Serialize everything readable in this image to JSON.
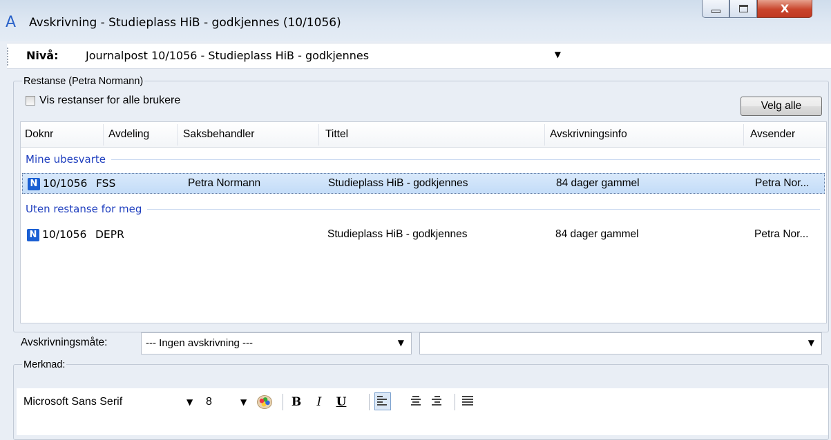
{
  "window": {
    "title": "Avskrivning - Studieplass HiB - godkjennes (10/1056)",
    "app_icon": "A",
    "close_glyph": "X"
  },
  "level": {
    "label": "Nivå:",
    "value": "Journalpost 10/1056 - Studieplass HiB - godkjennes"
  },
  "restanse": {
    "legend": "Restanse (Petra Normann)",
    "show_all_label": "Vis restanser for alle brukere",
    "select_all_label": "Velg alle",
    "columns": [
      "Doknr",
      "Avdeling",
      "Saksbehandler",
      "Tittel",
      "Avskrivningsinfo",
      "Avsender"
    ],
    "groups": [
      {
        "title": "Mine ubesvarte",
        "rows": [
          {
            "badge": "N",
            "doknr": "10/1056",
            "avdeling": "FSS",
            "saksbehandler": "Petra Normann",
            "tittel": "Studieplass HiB - godkjennes",
            "info": "84 dager gammel",
            "avsender": "Petra Nor..."
          }
        ]
      },
      {
        "title": "Uten restanse for meg",
        "rows": [
          {
            "badge": "N",
            "doknr": "10/1056",
            "avdeling": "DEPR",
            "saksbehandler": "",
            "tittel": "Studieplass HiB - godkjennes",
            "info": "84 dager gammel",
            "avsender": "Petra Nor..."
          }
        ]
      }
    ]
  },
  "avskrivning": {
    "label": "Avskrivningsmåte:",
    "value": "--- Ingen avskrivning ---",
    "second_value": ""
  },
  "merknad": {
    "legend": "Merknad:",
    "font_name": "Microsoft Sans Serif",
    "font_size": "8",
    "bold": "B",
    "italic": "I",
    "underline": "U"
  },
  "colors": {
    "accent": "#1f3fbf",
    "badge": "#1a5fd3",
    "selection": "#c3dcf8"
  }
}
